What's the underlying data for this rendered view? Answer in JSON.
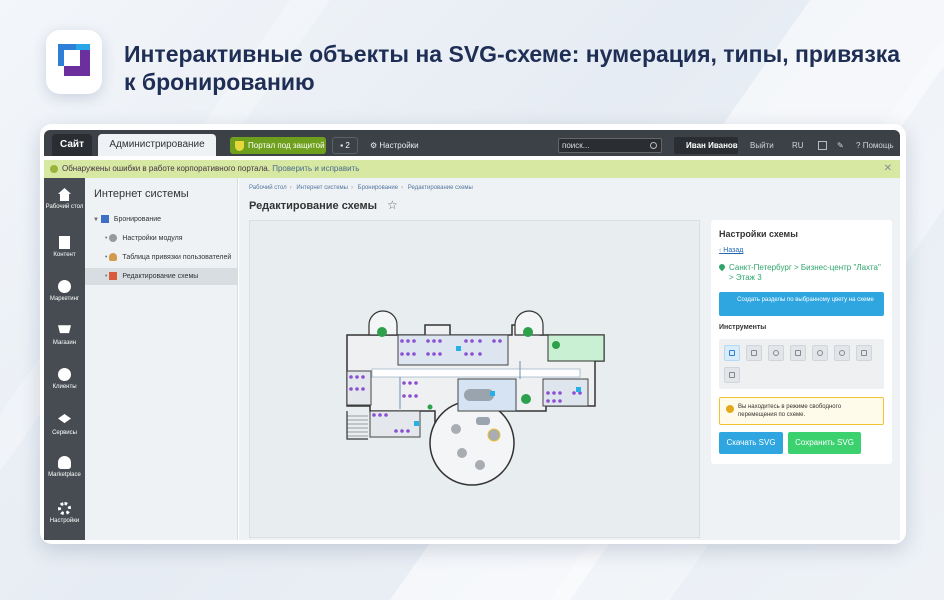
{
  "headline": "Интерактивные объекты на SVG-схеме: нумерация, типы, привязка к бронированию",
  "topbar": {
    "tab_site": "Сайт",
    "tab_admin": "Администрирование",
    "portal_button": "Портал под защитой",
    "notifications_count": "2",
    "settings_label": "Настройки",
    "search_placeholder": "поиск...",
    "user_name": "Иван Иванов",
    "logout_label": "Выйти",
    "lang_label": "RU",
    "help_label": "Помощь"
  },
  "alert": {
    "text": "Обнаружены ошибки в работе корпоративного портала.",
    "fix_link": "Проверить и исправить"
  },
  "leftnav": [
    {
      "label": "Рабочий стол",
      "icon": "home-icon"
    },
    {
      "label": "Контент",
      "icon": "document-icon"
    },
    {
      "label": "Маркетинг",
      "icon": "target-icon"
    },
    {
      "label": "Магазин",
      "icon": "cart-icon"
    },
    {
      "label": "Клиенты",
      "icon": "clients-icon"
    },
    {
      "label": "Сервисы",
      "icon": "layers-icon"
    },
    {
      "label": "Marketplace",
      "icon": "cloud-download-icon"
    },
    {
      "label": "Настройки",
      "icon": "gear-icon"
    }
  ],
  "sidebar": {
    "title": "Интернет системы",
    "items": [
      {
        "label": "Бронирование"
      },
      {
        "label": "Настройки модуля"
      },
      {
        "label": "Таблица привязки пользователей"
      },
      {
        "label": "Редактирование схемы"
      }
    ]
  },
  "breadcrumbs": [
    "Рабочий стол",
    "Интернет системы",
    "Бронирование",
    "Редактирование схемы"
  ],
  "page_title": "Редактирование схемы",
  "panel": {
    "title": "Настройки схемы",
    "back_label": "Назад",
    "location": "Санкт-Петербург > Бизнес-центр \"Лахта\" > Этаж 3",
    "sections_button": "Создать разделы по выбранному цвету на схеме",
    "tools_title": "Инструменты",
    "tools": [
      "pointer-icon",
      "close-box-icon",
      "eye-off-icon",
      "clipboard-icon",
      "link-icon",
      "group-link-icon",
      "delete-box-icon",
      "copy-icon"
    ],
    "info_text": "Вы находитесь в режиме свободного перемещения по схеме.",
    "download_button": "Скачать SVG",
    "save_button": "Сохранить SVG"
  },
  "colors": {
    "accent_blue": "#2fa6e0",
    "save_green": "#3bd16f",
    "portal_green": "#6fa01d",
    "dark_header": "#3c4148",
    "alert_bg": "#d7e8a3"
  }
}
